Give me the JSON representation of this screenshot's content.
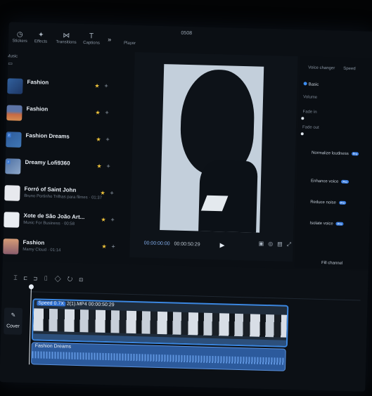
{
  "window": {
    "title": "0508"
  },
  "toolbar": {
    "tools": [
      {
        "label": "Stickers",
        "icon": "sticker-icon"
      },
      {
        "label": "Effects",
        "icon": "effects-icon"
      },
      {
        "label": "Transitions",
        "icon": "transitions-icon"
      },
      {
        "label": "Captions",
        "icon": "captions-icon"
      }
    ],
    "more_icon": "double-chevron-right-icon"
  },
  "player_label": "Player",
  "library": {
    "section_label": "Music",
    "items": [
      {
        "title": "Fashion",
        "subtitle": ""
      },
      {
        "title": "Fashion",
        "subtitle": ""
      },
      {
        "title": "Fashion Dreams",
        "subtitle": ""
      },
      {
        "title": "Dreamy Lofi9360",
        "subtitle": ""
      },
      {
        "title": "Forró of Saint John",
        "subtitle": "Bruno Portinho Trilhas para filmes · 01:37"
      },
      {
        "title": "Xote de São João Art...",
        "subtitle": "Music For Business · 00:58"
      },
      {
        "title": "Fashion",
        "subtitle": "Mamy Cloud · 01:14"
      }
    ]
  },
  "player": {
    "current_time": "00:00:00:00",
    "total_time": "00:00:50:29"
  },
  "right_panel": {
    "tabs": [
      "Voice changer",
      "Speed"
    ],
    "basic_label": "Basic",
    "volume_label": "Volume",
    "fade_in_label": "Fade in",
    "fade_out_label": "Fade out",
    "options": [
      "Normalize loudness",
      "Enhance voice",
      "Reduce noise",
      "Isolate voice"
    ],
    "fill_channel_label": "Fill channel",
    "toggle_badge": "Pro"
  },
  "timeline": {
    "cover_label": "Cover",
    "video_clip": {
      "speed": "Speed 0.7X",
      "name": "2(1).MP4",
      "duration": "00:00:50:29"
    },
    "audio_clip": {
      "name": "Fashion Dreams"
    }
  },
  "colors": {
    "accent": "#3b86df",
    "star": "#f0c43b",
    "background": "#0b0f14"
  }
}
